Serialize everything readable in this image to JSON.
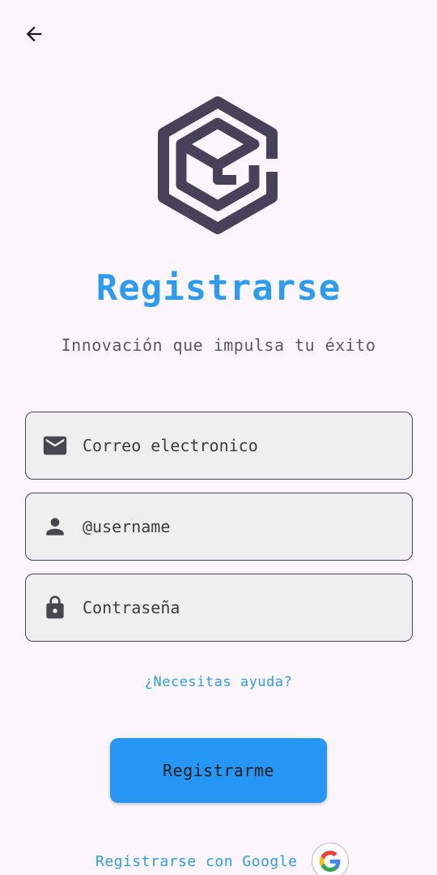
{
  "header": {
    "back_icon": "arrow-left-icon"
  },
  "brand": {
    "logo_icon": "hexagon-cube-logo"
  },
  "title": "Registrarse",
  "subtitle": "Innovación que impulsa tu éxito",
  "form": {
    "email": {
      "placeholder": "Correo electronico",
      "value": "",
      "icon": "mail-icon"
    },
    "username": {
      "placeholder": "@username",
      "value": "",
      "icon": "person-icon"
    },
    "password": {
      "placeholder": "Contraseña",
      "value": "",
      "icon": "lock-icon"
    }
  },
  "help_link": "¿Necesitas ayuda?",
  "submit_label": "Registrarme",
  "google": {
    "label": "Registrarse con Google",
    "icon": "google-icon"
  },
  "colors": {
    "accent": "#2c9bf0",
    "button": "#2596f3",
    "background": "#fcf6fc",
    "field_bg": "#efeff0",
    "logo": "#47425a"
  }
}
